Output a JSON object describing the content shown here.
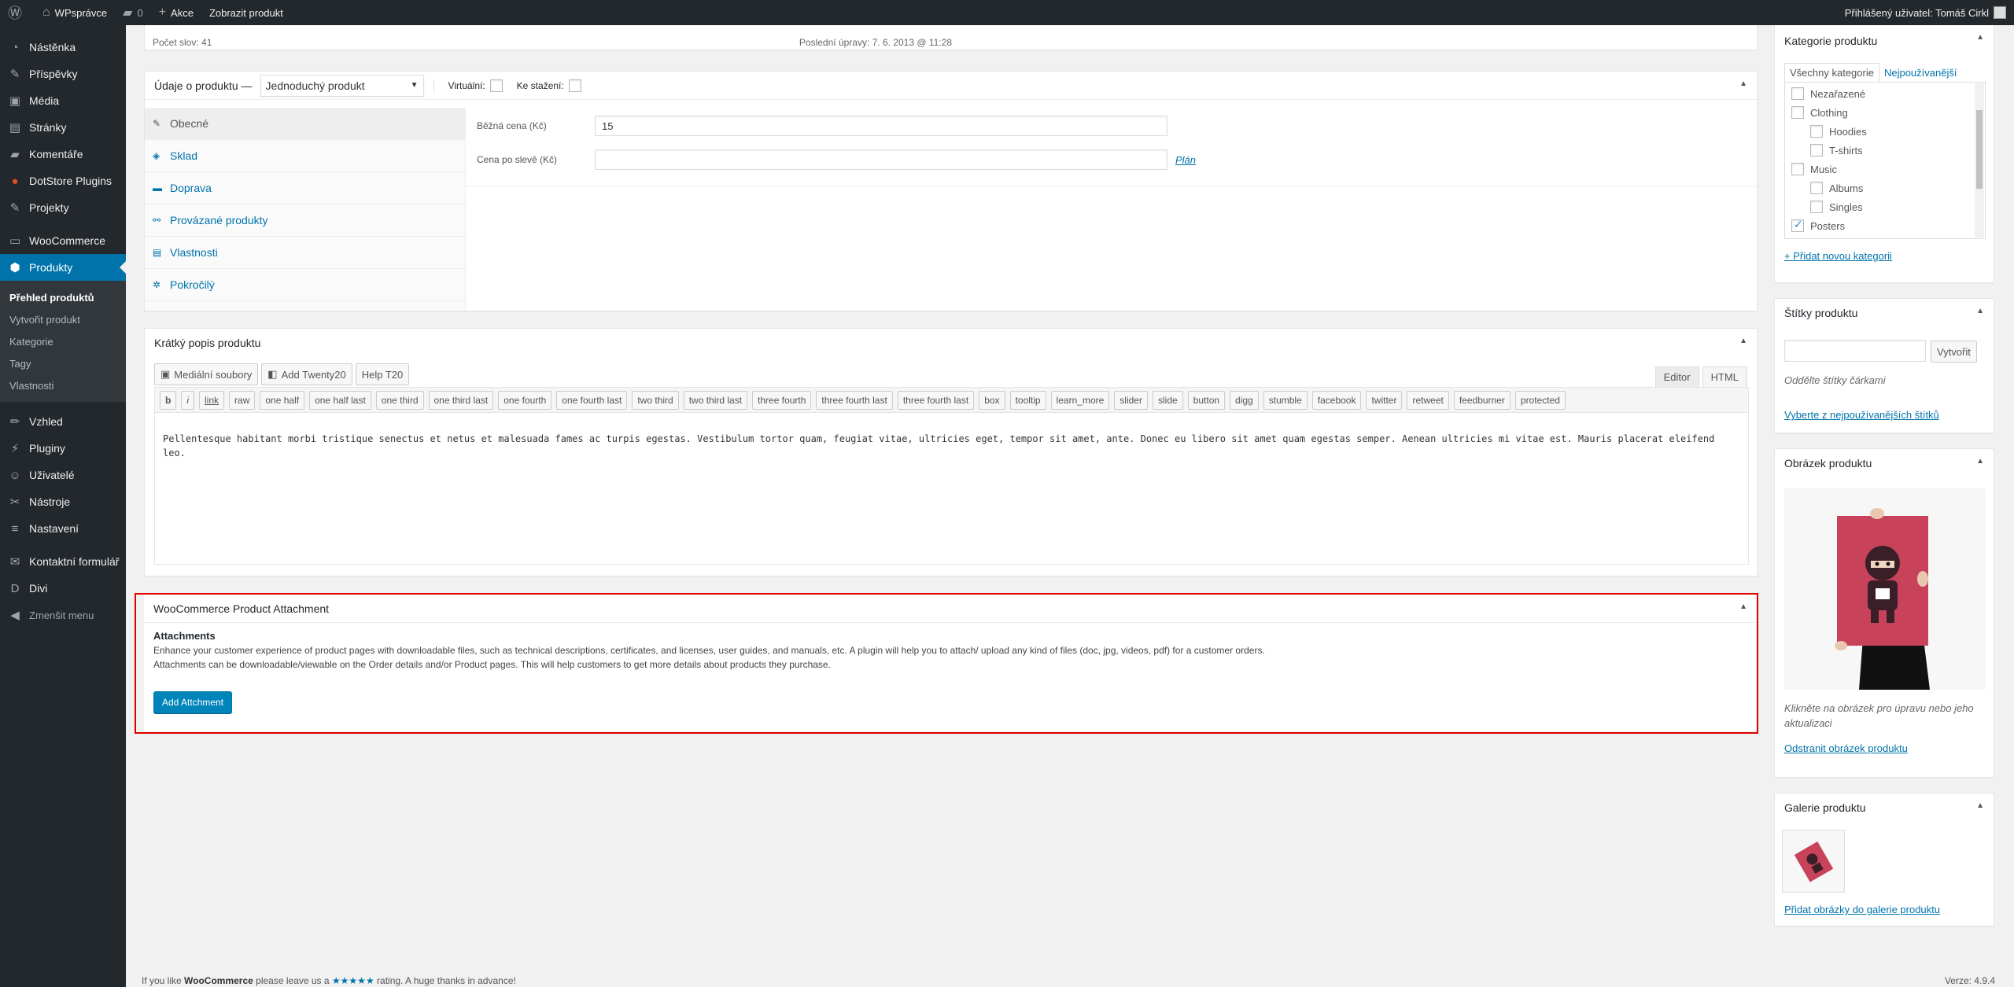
{
  "adminbar": {
    "site_name": "WPsprávce",
    "comments_count": "0",
    "new_label": "Akce",
    "view_product": "Zobrazit produkt",
    "howdy": "Přihlášený uživatel: Tomáš Cirkl"
  },
  "sidebar": {
    "items": [
      {
        "label": "Nástěnka",
        "icon": "dashboard-icon"
      },
      {
        "label": "Příspěvky",
        "icon": "pin-icon"
      },
      {
        "label": "Média",
        "icon": "media-icon"
      },
      {
        "label": "Stránky",
        "icon": "pages-icon"
      },
      {
        "label": "Komentáře",
        "icon": "comments-icon"
      },
      {
        "label": "DotStore Plugins",
        "icon": "dotstore-icon"
      },
      {
        "label": "Projekty",
        "icon": "pin-icon"
      },
      {
        "label": "WooCommerce",
        "icon": "woocommerce-icon"
      },
      {
        "label": "Produkty",
        "icon": "products-icon"
      }
    ],
    "submenu": [
      "Přehled produktů",
      "Vytvořit produkt",
      "Kategorie",
      "Tagy",
      "Vlastnosti"
    ],
    "items2": [
      {
        "label": "Vzhled",
        "icon": "brush-icon"
      },
      {
        "label": "Pluginy",
        "icon": "plugin-icon"
      },
      {
        "label": "Uživatelé",
        "icon": "users-icon"
      },
      {
        "label": "Nástroje",
        "icon": "tools-icon"
      },
      {
        "label": "Nastavení",
        "icon": "settings-icon"
      }
    ],
    "items3": [
      {
        "label": "Kontaktní formulář",
        "icon": "mail-icon"
      },
      {
        "label": "Divi",
        "icon": "divi-icon"
      }
    ],
    "collapse": "Zmenšit menu"
  },
  "editor_footer": {
    "word_count": "Počet slov: 41",
    "last_edit": "Poslední úpravy: 7. 6. 2013 @ 11:28"
  },
  "product_data": {
    "title": "Údaje o produktu —",
    "type_select": "Jednoduchý produkt",
    "virtual_label": "Virtuální:",
    "download_label": "Ke stažení:",
    "tabs": [
      "Obecné",
      "Sklad",
      "Doprava",
      "Provázané produkty",
      "Vlastnosti",
      "Pokročilý"
    ],
    "regular_price_label": "Běžná cena (Kč)",
    "regular_price_value": "15",
    "sale_price_label": "Cena po slevě (Kč)",
    "sale_price_value": "",
    "schedule_link": "Plán"
  },
  "short_desc": {
    "title": "Krátký popis produktu",
    "media_btn": "Mediální soubory",
    "add_t20": "Add Twenty20",
    "help_t20": "Help T20",
    "editor_tab": "Editor",
    "html_tab": "HTML",
    "quicktags": [
      "b",
      "i",
      "link",
      "raw",
      "one half",
      "one half last",
      "one third",
      "one third last",
      "one fourth",
      "one fourth last",
      "two third",
      "two third last",
      "three fourth",
      "three fourth last",
      "three fourth last",
      "box",
      "tooltip",
      "learn_more",
      "slider",
      "slide",
      "button",
      "digg",
      "stumble",
      "facebook",
      "twitter",
      "retweet",
      "feedburner",
      "protected"
    ],
    "content": "Pellentesque habitant morbi tristique senectus et netus et malesuada fames ac turpis egestas. Vestibulum tortor quam, feugiat vitae, ultricies eget, tempor sit amet, ante. Donec eu libero sit amet quam egestas semper. Aenean ultricies mi vitae est. Mauris placerat eleifend leo."
  },
  "attachment": {
    "title": "WooCommerce Product Attachment",
    "heading": "Attachments",
    "line1": "Enhance your customer experience of product pages with downloadable files, such as technical descriptions, certificates, and licenses, user guides, and manuals, etc. A plugin will help you to attach/ upload any kind of files (doc, jpg, videos, pdf) for a customer orders.",
    "line2": "Attachments can be downloadable/viewable on the Order details and/or Product pages. This will help customers to get more details about products they purchase.",
    "button": "Add Attchment"
  },
  "categories": {
    "title": "Kategorie produktu",
    "tab_all": "Všechny kategorie",
    "tab_popular": "Nejpoužívanější",
    "items": [
      {
        "label": "Nezařazené",
        "level": 0,
        "checked": false
      },
      {
        "label": "Clothing",
        "level": 0,
        "checked": false
      },
      {
        "label": "Hoodies",
        "level": 1,
        "checked": false
      },
      {
        "label": "T-shirts",
        "level": 1,
        "checked": false
      },
      {
        "label": "Music",
        "level": 0,
        "checked": false
      },
      {
        "label": "Albums",
        "level": 1,
        "checked": false
      },
      {
        "label": "Singles",
        "level": 1,
        "checked": false
      },
      {
        "label": "Posters",
        "level": 0,
        "checked": true
      }
    ],
    "add_new": "+ Přidat novou kategorii"
  },
  "tags": {
    "title": "Štítky produktu",
    "input_value": "",
    "add_btn": "Vytvořit",
    "hint": "Oddělte štítky čárkami",
    "choose": "Vyberte z nejpoužívanějších štítků"
  },
  "image": {
    "title": "Obrázek produktu",
    "hint": "Klikněte na obrázek pro úpravu nebo jeho aktualizaci",
    "remove": "Odstranit obrázek produktu"
  },
  "gallery": {
    "title": "Galerie produktu",
    "add": "Přidat obrázky do galerie produktu"
  },
  "footer": {
    "pre": "If you like ",
    "brand": "WooCommerce",
    "mid": " please leave us a ",
    "stars": "★★★★★",
    "post": " rating. A huge thanks in advance!",
    "version": "Verze: 4.9.4"
  },
  "colors": {
    "accent": "#0073aa",
    "highlight": "#e00000",
    "adminbar": "#23282d"
  }
}
